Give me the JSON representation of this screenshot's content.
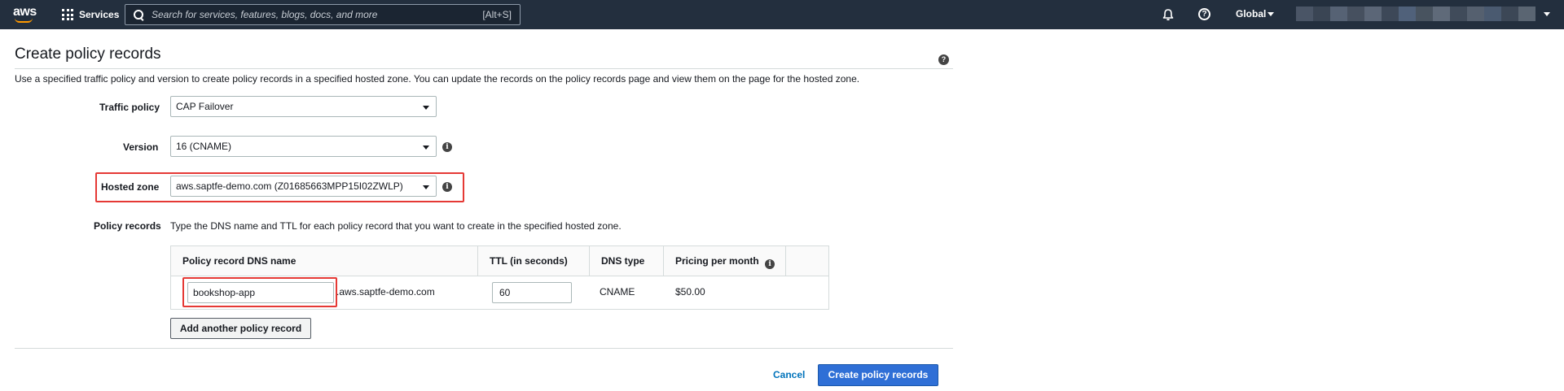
{
  "topnav": {
    "logo_text": "aws",
    "services_label": "Services",
    "search_placeholder": "Search for services, features, blogs, docs, and more",
    "search_shortcut": "[Alt+S]",
    "region_label": "Global",
    "help_glyph": "?",
    "account_blur_colors": [
      "#4a5566",
      "#3a4554",
      "#566274",
      "#46505f",
      "#5b6677",
      "#3d4858",
      "#50617a",
      "#48535f",
      "#5f6a79",
      "#404b5a",
      "#55606f",
      "#4a5a70",
      "#3c4756",
      "#5a6572"
    ]
  },
  "page": {
    "title": "Create policy records",
    "help_glyph": "?",
    "description": "Use a specified traffic policy and version to create policy records in a specified hosted zone. You can update the records on the policy records page and view them on the page for the hosted zone."
  },
  "form": {
    "traffic_policy_label": "Traffic policy",
    "traffic_policy_value": "CAP Failover",
    "version_label": "Version",
    "version_value": "16 (CNAME)",
    "hosted_zone_label": "Hosted zone",
    "hosted_zone_value": "aws.saptfe-demo.com (Z01685663MPP15I02ZWLP)",
    "policy_records_label": "Policy records",
    "policy_records_hint": "Type the DNS name and TTL for each policy record that you want to create in the specified hosted zone.",
    "info_glyph": "i"
  },
  "table": {
    "headers": {
      "dns_name": "Policy record DNS name",
      "ttl": "TTL (in seconds)",
      "dns_type": "DNS type",
      "pricing": "Pricing per month"
    },
    "row": {
      "dns_name_value": "bookshop-app",
      "dns_suffix": ".aws.saptfe-demo.com",
      "ttl_value": "60",
      "dns_type": "CNAME",
      "price": "$50.00"
    }
  },
  "actions": {
    "add_record_label": "Add another policy record",
    "cancel_label": "Cancel",
    "create_label": "Create policy records"
  },
  "colors": {
    "nav_bg": "#232f3e",
    "primary": "#2f6fd6",
    "link": "#0073bb",
    "highlight": "#e53935"
  }
}
